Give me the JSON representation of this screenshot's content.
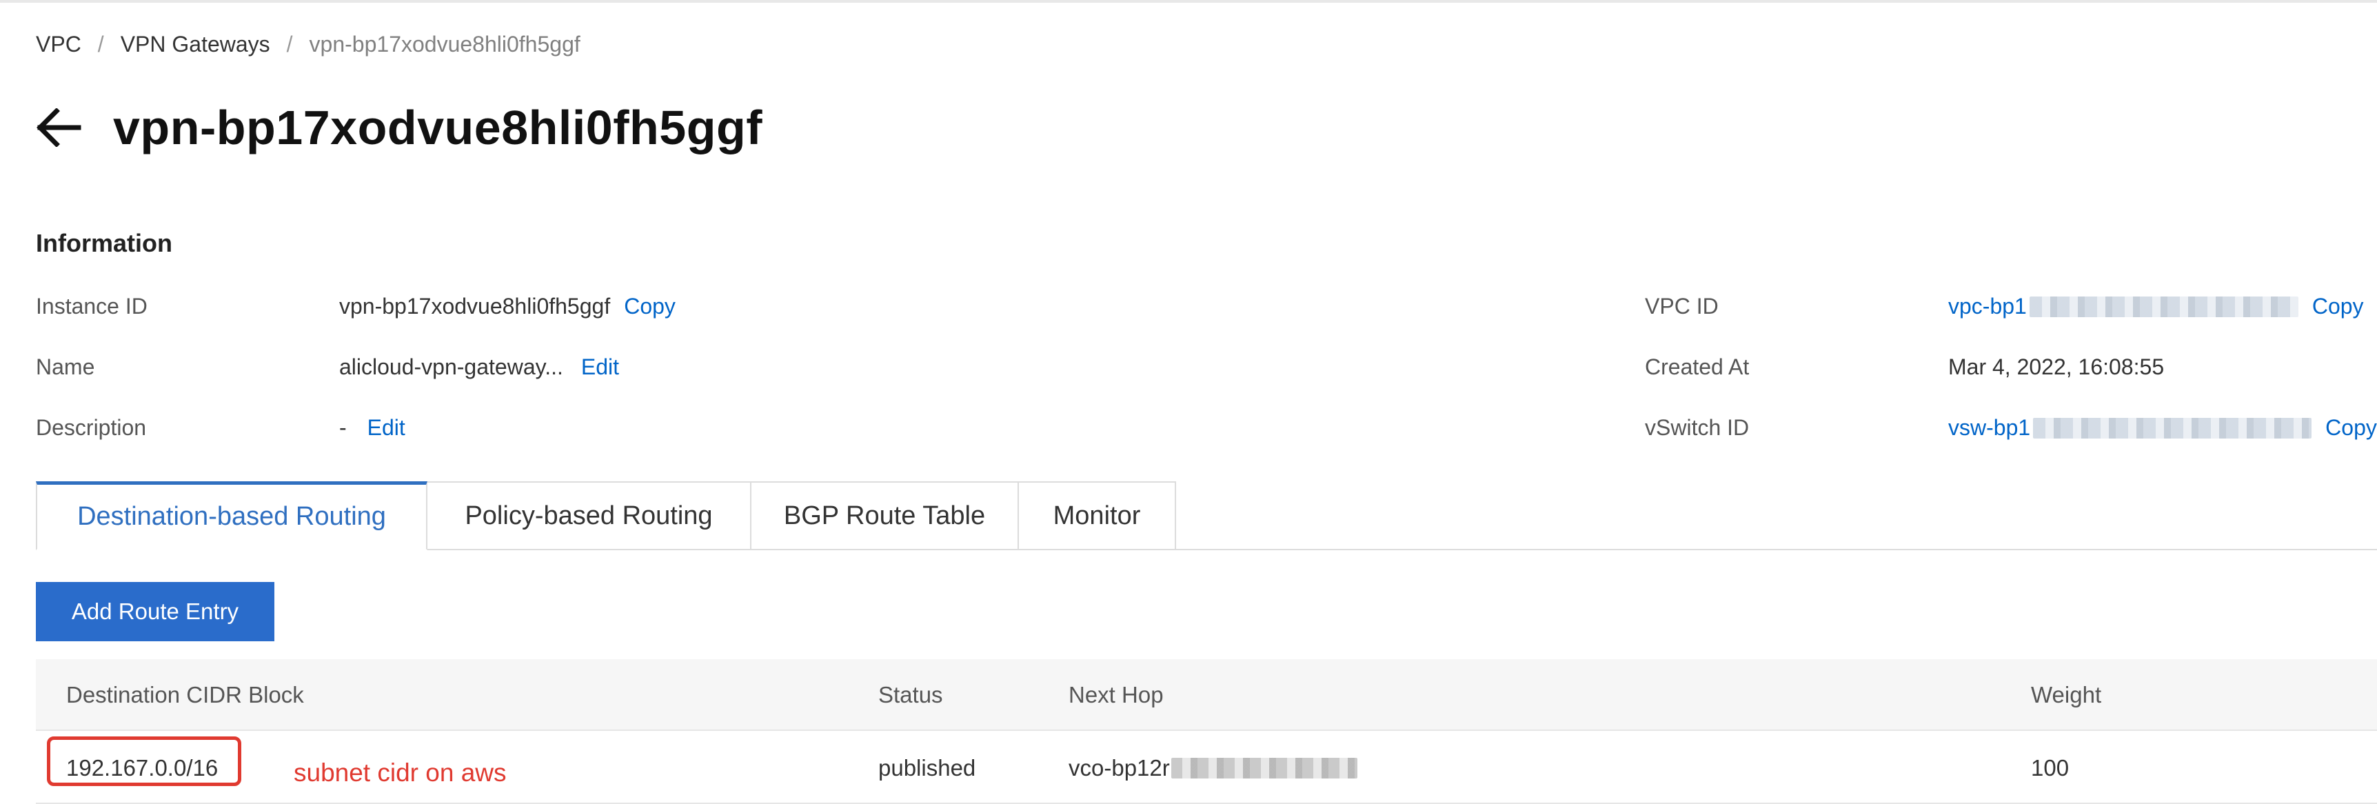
{
  "breadcrumb": {
    "items": [
      "VPC",
      "VPN Gateways",
      "vpn-bp17xodvue8hli0fh5ggf"
    ],
    "separator": "/"
  },
  "header": {
    "title": "vpn-bp17xodvue8hli0fh5ggf"
  },
  "information": {
    "section_title": "Information",
    "instance_id": {
      "label": "Instance ID",
      "value": "vpn-bp17xodvue8hli0fh5ggf",
      "action": "Copy"
    },
    "name": {
      "label": "Name",
      "value": "alicloud-vpn-gateway...",
      "action": "Edit"
    },
    "description": {
      "label": "Description",
      "value": "-",
      "action": "Edit"
    },
    "vpc_id": {
      "label": "VPC ID",
      "value": "vpc-bp1",
      "action": "Copy"
    },
    "created_at": {
      "label": "Created At",
      "value": "Mar 4, 2022, 16:08:55"
    },
    "vswitch_id": {
      "label": "vSwitch ID",
      "value": "vsw-bp1",
      "action": "Copy"
    }
  },
  "tabs": [
    {
      "label": "Destination-based Routing",
      "active": true
    },
    {
      "label": "Policy-based Routing",
      "active": false
    },
    {
      "label": "BGP Route Table",
      "active": false
    },
    {
      "label": "Monitor",
      "active": false
    }
  ],
  "toolbar": {
    "add_label": "Add Route Entry"
  },
  "table": {
    "columns": [
      "Destination CIDR Block",
      "Status",
      "Next Hop",
      "Weight"
    ],
    "rows": [
      {
        "cidr": "192.167.0.0/16",
        "status": "published",
        "next_hop": "vco-bp12r",
        "weight": "100"
      }
    ]
  },
  "annotation": {
    "text": "subnet cidr on aws",
    "color": "#e03a30"
  },
  "colors": {
    "link": "#0064c8",
    "primary_button": "#2a6ccb",
    "active_tab": "#2f6fc0"
  }
}
